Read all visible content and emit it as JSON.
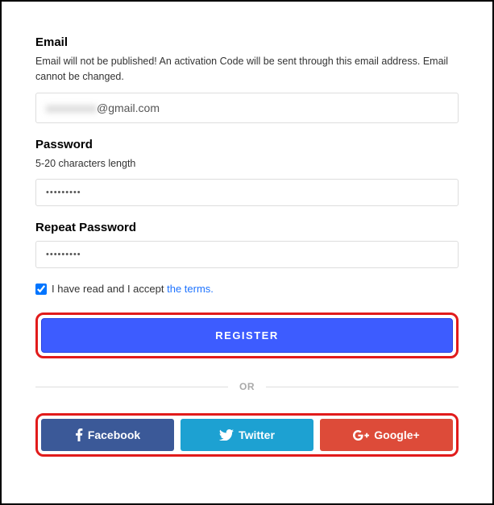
{
  "email": {
    "label": "Email",
    "help": "Email will not be published! An activation Code will be sent through this email address. Email cannot be changed.",
    "value_suffix": "@gmail.com"
  },
  "password": {
    "label": "Password",
    "help": "5-20 characters length",
    "value": "•••••••••"
  },
  "repeat_password": {
    "label": "Repeat Password",
    "value": "•••••••••"
  },
  "terms": {
    "checked": true,
    "prefix": "I have read and I accept ",
    "link_text": "the terms.",
    "period": ""
  },
  "register_button": "REGISTER",
  "divider": "OR",
  "social": {
    "facebook": "Facebook",
    "twitter": "Twitter",
    "google": "Google+"
  }
}
